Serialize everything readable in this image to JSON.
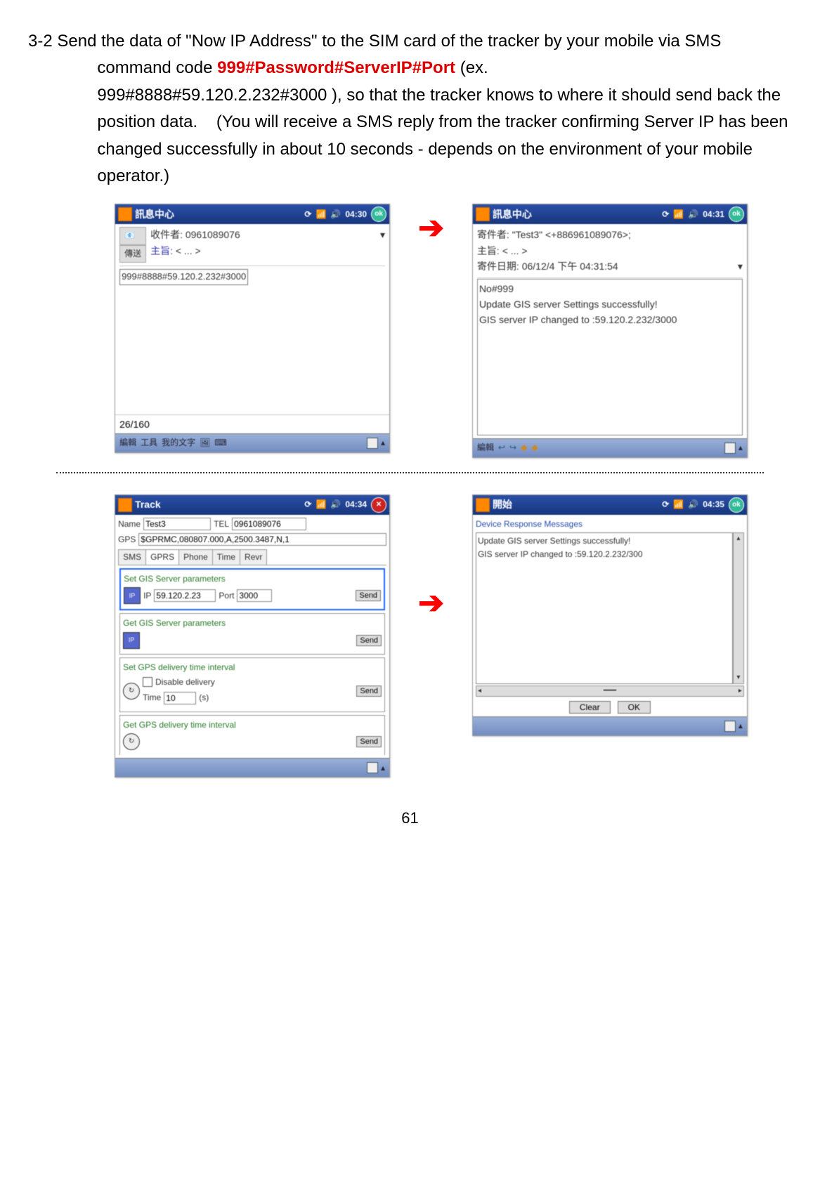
{
  "doc": {
    "step": "3-2",
    "para1": "Send the data of \"Now IP Address\" to the SIM card of the tracker by your mobile via SMS command code ",
    "cmd": "999#Password#ServerIP#Port",
    "cmd_after": " (ex.",
    "para2": "999#8888#59.120.2.232#3000 ), so that the tracker knows to where it should send back the position data.    (You will receive a SMS reply from the tracker confirming Server IP has been changed successfully in about 10 seconds - depends on the environment of your mobile operator.)",
    "page_number": "61"
  },
  "p1": {
    "title": "訊息中心",
    "time": "04:30",
    "recipient_label": "收件者:",
    "recipient": "0961089076",
    "subject_label": "主旨:",
    "subject": "< ... >",
    "send_tab": "傳送",
    "input": "999#8888#59.120.2.232#3000",
    "count": "26/160",
    "bottom": [
      "編輯",
      "工具",
      "我的文字"
    ]
  },
  "p2": {
    "title": "訊息中心",
    "time": "04:31",
    "sender_label": "寄件者:",
    "sender": "\"Test3\" <+886961089076>;",
    "subject_label": "主旨:",
    "subject": "< ... >",
    "date_label": "寄件日期:",
    "date": "06/12/4 下午 04:31:54",
    "l1": "No#999",
    "l2": "Update GIS server Settings successfully!",
    "l3": "GIS server IP changed to :59.120.2.232/3000",
    "bottom": [
      "編輯"
    ]
  },
  "p3": {
    "title": "Track",
    "time": "04:34",
    "name_label": "Name",
    "name_val": "Test3",
    "tel_label": "TEL",
    "tel_val": "0961089076",
    "gps_label": "GPS",
    "gps_val": "$GPRMC,080807.000,A,2500.3487,N,1",
    "tabs": [
      "SMS",
      "GPRS",
      "Phone",
      "Time",
      "Revr"
    ],
    "sec1_title": "Set GIS Server parameters",
    "ip_label": "IP",
    "ip_val": "59.120.2.23",
    "port_label": "Port",
    "port_val": "3000",
    "send": "Send",
    "sec2_title": "Get GIS Server parameters",
    "sec3_title": "Set GPS delivery time interval",
    "disable_label": "Disable delivery",
    "time_label": "Time",
    "time_val": "10",
    "time_unit": "(s)",
    "sec4_title": "Get GPS delivery time interval"
  },
  "p4": {
    "title": "開始",
    "time": "04:35",
    "heading": "Device Response Messages",
    "l1": "Update GIS server Settings successfully!",
    "l2": "GIS server IP changed to :59.120.2.232/300",
    "clear": "Clear",
    "ok": "OK"
  }
}
